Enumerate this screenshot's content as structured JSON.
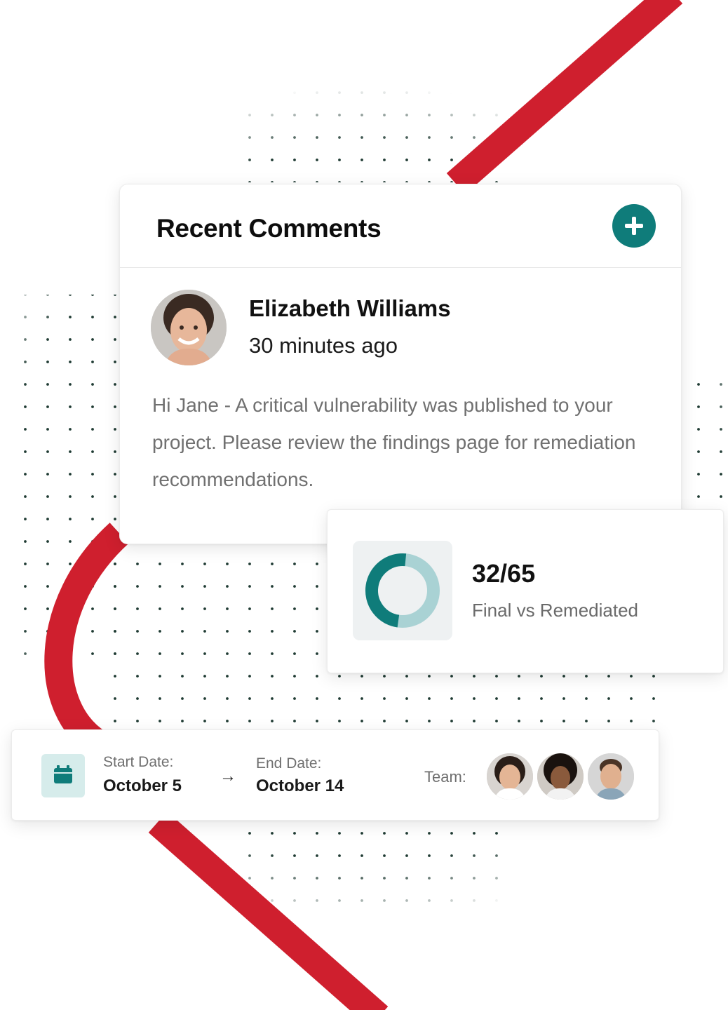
{
  "comments": {
    "title": "Recent Comments",
    "add_icon": "plus-icon",
    "item": {
      "author": "Elizabeth Williams",
      "time": "30 minutes ago",
      "body": "Hi Jane - A critical vulnerability was published to your project. Please review the findings page for remediation recommendations."
    }
  },
  "stats": {
    "value": "32/65",
    "label": "Final vs Remediated",
    "fraction": 0.4923
  },
  "timeline": {
    "start_label": "Start Date:",
    "start_value": "October 5",
    "end_label": "End Date:",
    "end_value": "October 14",
    "arrow": "→",
    "team_label": "Team:",
    "team_count": 3
  },
  "colors": {
    "accent_teal": "#0f7c7a",
    "donut_light": "#a9d2d4",
    "ribbon_red": "#cf1f2e",
    "dot": "#1f3b33"
  }
}
